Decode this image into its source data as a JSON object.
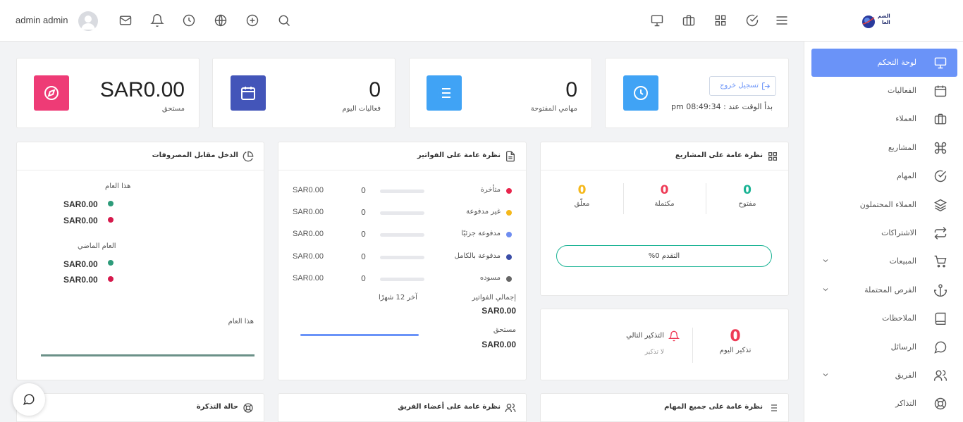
{
  "topbar": {
    "user_name": "admin admin",
    "left_icons": [
      "mail-icon",
      "bell-icon",
      "clock-icon",
      "globe-icon",
      "plus-circle-icon",
      "search-icon"
    ],
    "right_icons": [
      "monitor-icon",
      "briefcase-icon",
      "grid-icon",
      "check-circle-icon",
      "menu-icon"
    ],
    "logo_text_line1": "الشم",
    "logo_text_line2": "العا"
  },
  "sidebar": {
    "items": [
      {
        "label": "لوحة التحكم",
        "icon": "monitor-icon",
        "active": true
      },
      {
        "label": "الفعاليات",
        "icon": "calendar-icon"
      },
      {
        "label": "العملاء",
        "icon": "briefcase-icon"
      },
      {
        "label": "المشاريع",
        "icon": "command-icon"
      },
      {
        "label": "المهام",
        "icon": "check-circle-icon"
      },
      {
        "label": "العملاء المحتملون",
        "icon": "layers-icon"
      },
      {
        "label": "الاشتراكات",
        "icon": "repeat-icon"
      },
      {
        "label": "المبيعات",
        "icon": "cart-icon",
        "has_children": true
      },
      {
        "label": "الفرص المحتملة",
        "icon": "anchor-icon",
        "has_children": true
      },
      {
        "label": "الملاحظات",
        "icon": "book-icon"
      },
      {
        "label": "الرسائل",
        "icon": "message-icon"
      },
      {
        "label": "الفريق",
        "icon": "users-icon",
        "has_children": true
      },
      {
        "label": "التذاكر",
        "icon": "lifebuoy-icon"
      }
    ]
  },
  "stats": {
    "clock": {
      "button": "تسجيل خروج",
      "started": "بدأ الوقت عند : 08:49:34 pm",
      "color": "#40a3f5"
    },
    "open_tasks": {
      "value": "0",
      "label": "مهامي المفتوحة",
      "color": "#40a3f5"
    },
    "today_events": {
      "value": "0",
      "label": "فعاليات اليوم",
      "color": "#4355b9"
    },
    "due": {
      "value": "SAR0.00",
      "label": "مستحق",
      "color": "#ee3b76"
    }
  },
  "projects": {
    "title": "نظرة عامة على المشاريع",
    "open": {
      "value": "0",
      "label": "مفتوح",
      "color": "#1ab394"
    },
    "completed": {
      "value": "0",
      "label": "مكتملة",
      "color": "#ee3b56"
    },
    "hold": {
      "value": "0",
      "label": "معلّق",
      "color": "#f5b81b"
    },
    "progress_label": "التقدم 0%",
    "progress": 0
  },
  "reminders": {
    "today_value": "0",
    "today_label": "تذكير اليوم",
    "next_label": "التذكير التالي",
    "none_label": "لا تذكير"
  },
  "invoices": {
    "title": "نظرة عامة على الفواتير",
    "rows": [
      {
        "label": "متأخرة",
        "count": "0",
        "amount": "SAR0.00",
        "color": "#e8254c"
      },
      {
        "label": "غير مدفوعة",
        "count": "0",
        "amount": "SAR0.00",
        "color": "#f5b81b"
      },
      {
        "label": "مدفوعة جزئيًا",
        "count": "0",
        "amount": "SAR0.00",
        "color": "#6f8df0"
      },
      {
        "label": "مدفوعة بالكامل",
        "count": "0",
        "amount": "SAR0.00",
        "color": "#3b4ea7"
      },
      {
        "label": "مسوده",
        "count": "0",
        "amount": "SAR0.00",
        "color": "#666666"
      }
    ],
    "total_label": "إجمالي الفواتير",
    "total_value": "SAR0.00",
    "period_label": "آخر 12 شهرًا",
    "due_label": "مستحق",
    "due_value": "SAR0.00"
  },
  "income": {
    "title": "الدخل مقابل المصروفات",
    "this_year_label": "هذا العام",
    "this_year_income": "SAR0.00",
    "this_year_expense": "SAR0.00",
    "last_year_label": "العام الماضي",
    "last_year_income": "SAR0.00",
    "last_year_expense": "SAR0.00",
    "chart_label": "هذا العام",
    "income_color": "#2d9b7a",
    "expense_color": "#d6194c"
  },
  "bottom": {
    "tasks_title": "نظرة عامة على جميع المهام",
    "team_title": "نظرة عامة على أعضاء الفريق",
    "tickets_title": "حالة التذكرة"
  }
}
